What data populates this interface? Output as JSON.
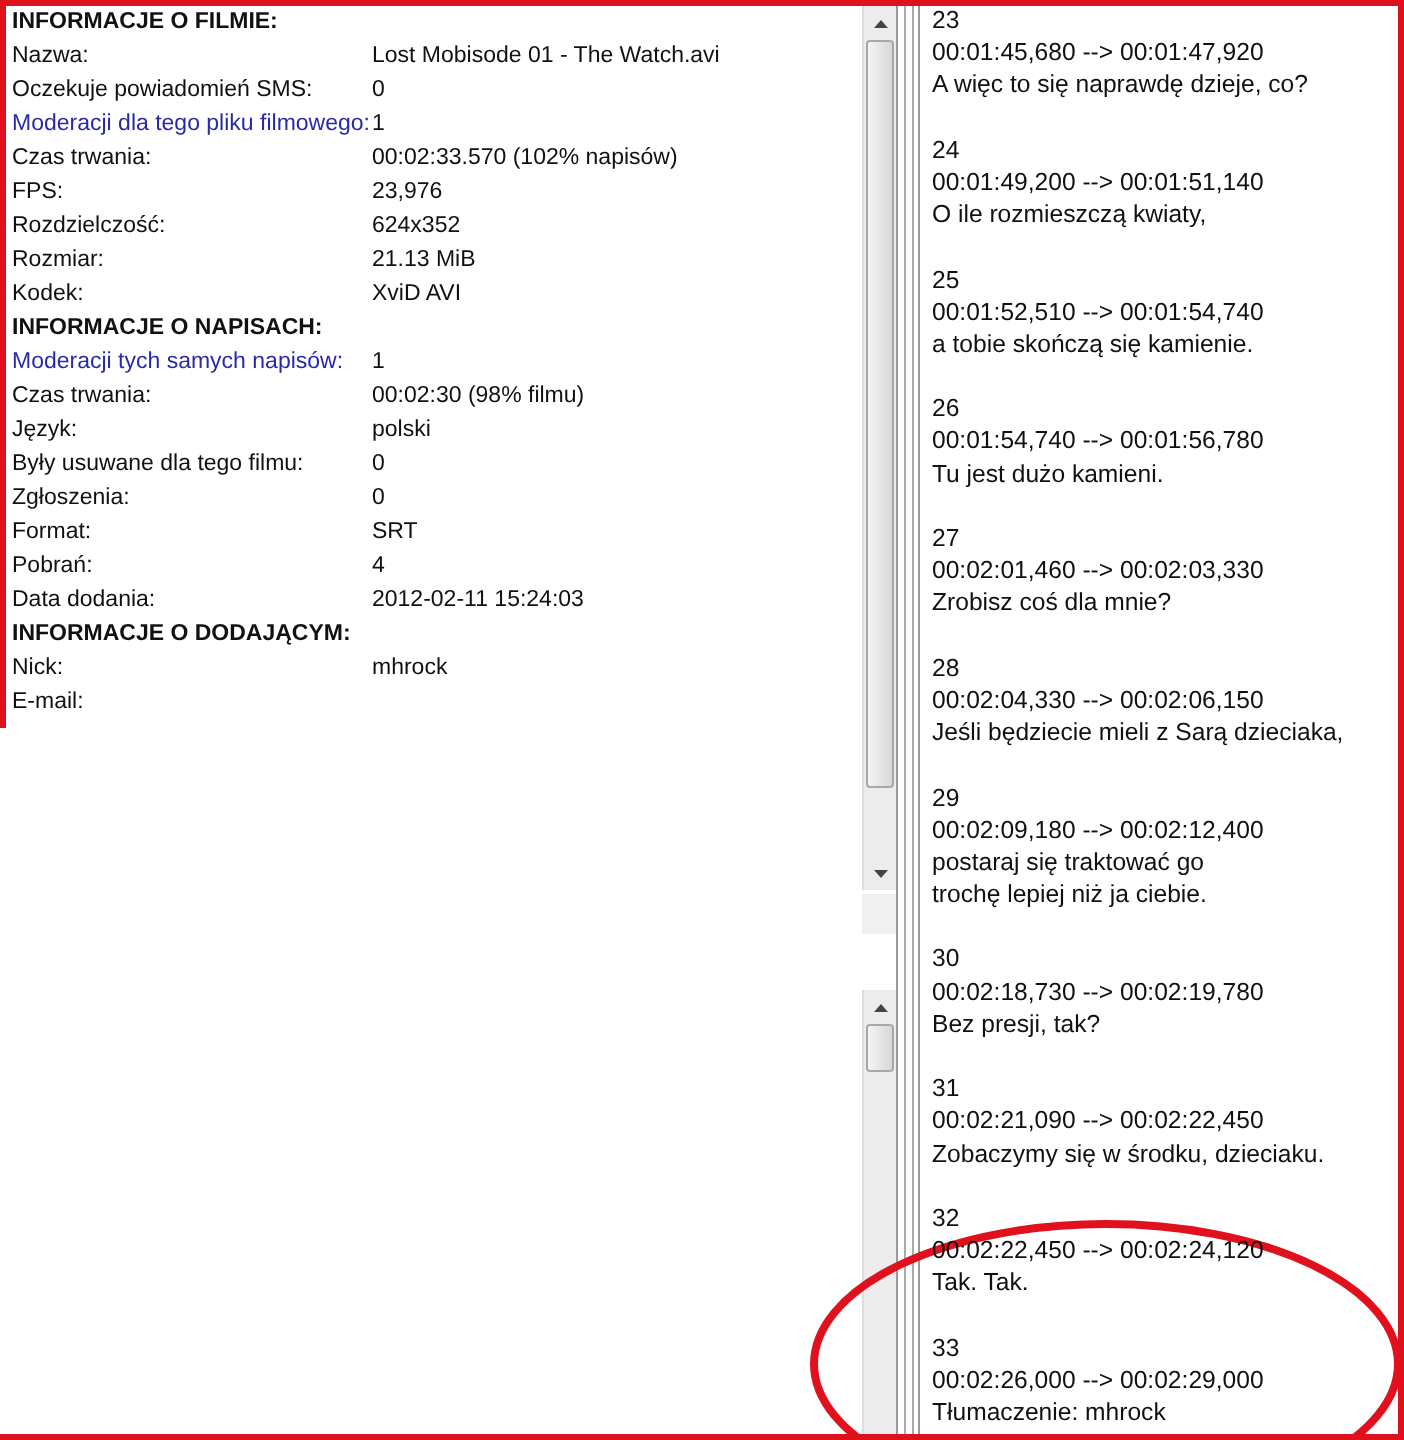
{
  "info_sections": [
    {
      "title": "INFORMACJE O FILMIE:",
      "rows": [
        {
          "label": "Nazwa:",
          "value": "Lost Mobisode 01 - The Watch.avi",
          "kind": "plain"
        },
        {
          "label": "Oczekuje powiadomień SMS:",
          "value": "0",
          "kind": "plain"
        },
        {
          "label": "Moderacji dla tego pliku filmowego:",
          "value": "1",
          "kind": "link"
        },
        {
          "label": "Czas trwania:",
          "value": "00:02:33.570 (102% napisów)",
          "kind": "plain"
        },
        {
          "label": "FPS:",
          "value": "23,976",
          "kind": "plain"
        },
        {
          "label": "Rozdzielczość:",
          "value": "624x352",
          "kind": "plain"
        },
        {
          "label": "Rozmiar:",
          "value": "21.13 MiB",
          "kind": "plain"
        },
        {
          "label": "Kodek:",
          "value": "XviD AVI",
          "kind": "plain"
        }
      ]
    },
    {
      "title": "INFORMACJE O NAPISACH:",
      "rows": [
        {
          "label": "Moderacji tych samych napisów:",
          "value": "1",
          "kind": "link"
        },
        {
          "label": "Czas trwania:",
          "value": "00:02:30 (98% filmu)",
          "kind": "plain"
        },
        {
          "label": "Język:",
          "value": "polski",
          "kind": "plain"
        },
        {
          "label": "Były usuwane dla tego filmu:",
          "value": "0",
          "kind": "plain"
        },
        {
          "label": "Zgłoszenia:",
          "value": "0",
          "kind": "plain"
        },
        {
          "label": "Format:",
          "value": "SRT",
          "kind": "plain"
        },
        {
          "label": "Pobrań:",
          "value": "4",
          "kind": "plain"
        },
        {
          "label": "Data dodania:",
          "value": "2012-02-11 15:24:03",
          "kind": "plain"
        }
      ]
    },
    {
      "title": "INFORMACJE O DODAJĄCYM:",
      "rows": [
        {
          "label": "Nick:",
          "value": "mhrock",
          "kind": "plain"
        },
        {
          "label": "E-mail:",
          "kind": "plain"
        }
      ]
    }
  ],
  "subtitles": [
    {
      "index": "23",
      "time": "00:01:45,680 --> 00:01:47,920",
      "lines": [
        "A więc to się naprawdę dzieje, co?"
      ]
    },
    {
      "index": "24",
      "time": "00:01:49,200 --> 00:01:51,140",
      "lines": [
        "O ile rozmieszczą kwiaty,"
      ]
    },
    {
      "index": "25",
      "time": "00:01:52,510 --> 00:01:54,740",
      "lines": [
        "a tobie skończą się kamienie."
      ]
    },
    {
      "index": "26",
      "time": "00:01:54,740 --> 00:01:56,780",
      "lines": [
        "Tu jest dużo kamieni."
      ]
    },
    {
      "index": "27",
      "time": "00:02:01,460 --> 00:02:03,330",
      "lines": [
        "Zrobisz coś dla mnie?"
      ]
    },
    {
      "index": "28",
      "time": "00:02:04,330 --> 00:02:06,150",
      "lines": [
        "Jeśli będziecie mieli z Sarą dzieciaka,"
      ]
    },
    {
      "index": "29",
      "time": "00:02:09,180 --> 00:02:12,400",
      "lines": [
        "postaraj się traktować go",
        "trochę lepiej niż ja ciebie."
      ]
    },
    {
      "index": "30",
      "time": "00:02:18,730 --> 00:02:19,780",
      "lines": [
        "Bez presji, tak?"
      ]
    },
    {
      "index": "31",
      "time": "00:02:21,090 --> 00:02:22,450",
      "lines": [
        "Zobaczymy się w środku, dzieciaku."
      ]
    },
    {
      "index": "32",
      "time": "00:02:22,450 --> 00:02:24,120",
      "lines": [
        "Tak. Tak."
      ]
    },
    {
      "index": "33",
      "time": "00:02:26,000 --> 00:02:29,000",
      "lines": [
        "Tłumaczenie: mhrock"
      ]
    }
  ]
}
